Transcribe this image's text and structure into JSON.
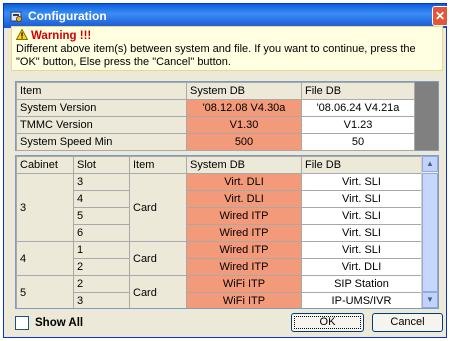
{
  "window": {
    "title": "Configuration",
    "close_glyph": "✕",
    "icon": "settings-app-icon"
  },
  "warning": {
    "heading": "Warning !!!",
    "icon": "warning-icon",
    "line1": "Different above item(s) between system and file. If you want to continue, press the",
    "line2": "\"OK\" button,  Else press the \"Cancel\" button."
  },
  "summary": {
    "headers": [
      "Item",
      "System DB",
      "File DB"
    ],
    "rows": [
      {
        "item": "System Version",
        "system": "'08.12.08 V4.30a",
        "file": "'08.06.24 V4.21a"
      },
      {
        "item": "TMMC Version",
        "system": "V1.30",
        "file": "V1.23"
      },
      {
        "item": "System Speed Min",
        "system": "500",
        "file": "50"
      }
    ]
  },
  "detail": {
    "headers": [
      "Cabinet",
      "Slot",
      "Item",
      "System DB",
      "File DB"
    ],
    "groups": [
      {
        "cabinet": "3",
        "item": "Card",
        "rows": [
          {
            "slot": "3",
            "system": "Virt. DLI",
            "file": "Virt. SLI"
          },
          {
            "slot": "4",
            "system": "Virt. DLI",
            "file": "Virt. SLI"
          },
          {
            "slot": "5",
            "system": "Wired ITP",
            "file": "Virt. SLI"
          },
          {
            "slot": "6",
            "system": "Wired ITP",
            "file": "Virt. SLI"
          }
        ]
      },
      {
        "cabinet": "4",
        "item": "Card",
        "rows": [
          {
            "slot": "1",
            "system": "Wired ITP",
            "file": "Virt. SLI"
          },
          {
            "slot": "2",
            "system": "Wired ITP",
            "file": "Virt. DLI"
          }
        ]
      },
      {
        "cabinet": "5",
        "item": "Card",
        "rows": [
          {
            "slot": "2",
            "system": "WiFi ITP",
            "file": "SIP Station"
          },
          {
            "slot": "3",
            "system": "WiFi ITP",
            "file": "IP-UMS/IVR"
          }
        ]
      }
    ]
  },
  "controls": {
    "show_all": "Show All",
    "show_all_checked": false,
    "ok": "OK",
    "cancel": "Cancel"
  },
  "colors": {
    "mismatch": "#f39a7a",
    "title_bar": "#0a5fd8",
    "warning_text": "#d40000"
  }
}
